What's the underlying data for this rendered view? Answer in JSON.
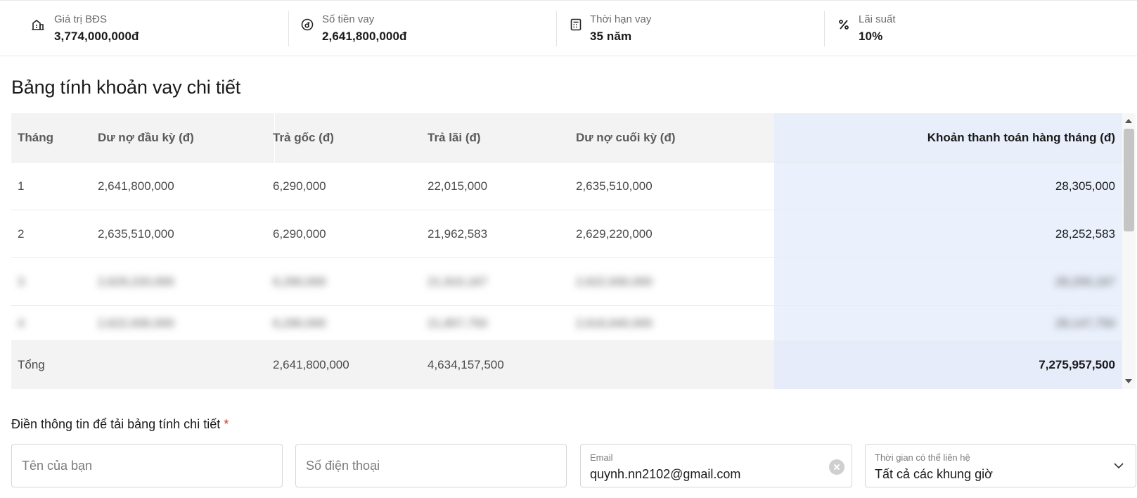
{
  "summary": {
    "property_value": {
      "label": "Giá trị BĐS",
      "value": "3,774,000,000đ",
      "icon": "building-icon"
    },
    "loan_amount": {
      "label": "Số tiền vay",
      "value": "2,641,800,000đ",
      "icon": "dong-coin-icon"
    },
    "loan_term": {
      "label": "Thời hạn vay",
      "value": "35 năm",
      "icon": "calculator-icon"
    },
    "interest_rate": {
      "label": "Lãi suất",
      "value": "10%",
      "icon": "percent-icon"
    }
  },
  "table": {
    "title": "Bảng tính khoản vay chi tiết",
    "columns": [
      "Tháng",
      "Dư nợ đầu kỳ (đ)",
      "Trả gốc (đ)",
      "Trả lãi (đ)",
      "Dư nợ cuối kỳ (đ)",
      "Khoản thanh toán hàng tháng (đ)"
    ],
    "rows": [
      [
        "1",
        "2,641,800,000",
        "6,290,000",
        "22,015,000",
        "2,635,510,000",
        "28,305,000"
      ],
      [
        "2",
        "2,635,510,000",
        "6,290,000",
        "21,962,583",
        "2,629,220,000",
        "28,252,583"
      ],
      [
        "3",
        "2,629,220,000",
        "6,290,000",
        "21,910,167",
        "2,622,930,000",
        "28,200,167"
      ],
      [
        "4",
        "2,622,930,000",
        "6,290,000",
        "21,857,750",
        "2,616,640,000",
        "28,147,750"
      ]
    ],
    "total": {
      "label": "Tổng",
      "principal": "2,641,800,000",
      "interest": "4,634,157,500",
      "payment": "7,275,957,500"
    }
  },
  "form": {
    "title": "Điền thông tin để tải bảng tính chi tiết",
    "required_mark": "*",
    "name_placeholder": "Tên của bạn",
    "phone_placeholder": "Số điện thoại",
    "email_label": "Email",
    "email_value": "quynh.nn2102@gmail.com",
    "contact_time_label": "Thời gian có thể liên hệ",
    "contact_time_value": "Tất cả các khung giờ"
  },
  "colors": {
    "highlight_column": "#eaf0fc",
    "required": "#d93025",
    "header_bg": "#f3f3f3"
  }
}
